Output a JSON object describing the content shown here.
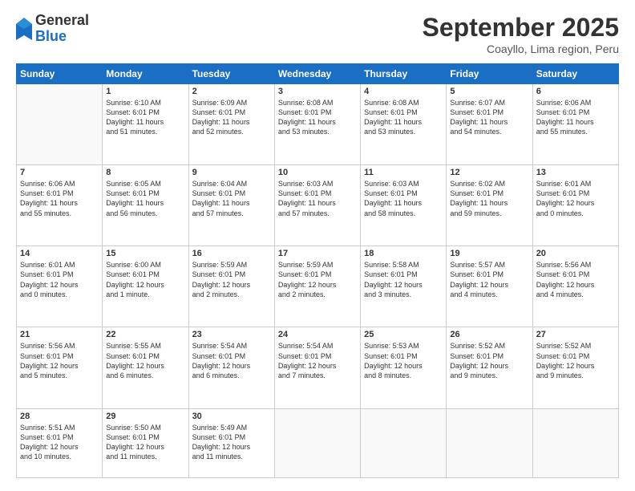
{
  "logo": {
    "general": "General",
    "blue": "Blue"
  },
  "header": {
    "title": "September 2025",
    "subtitle": "Coayllo, Lima region, Peru"
  },
  "days_of_week": [
    "Sunday",
    "Monday",
    "Tuesday",
    "Wednesday",
    "Thursday",
    "Friday",
    "Saturday"
  ],
  "weeks": [
    [
      {
        "day": "",
        "info": ""
      },
      {
        "day": "1",
        "info": "Sunrise: 6:10 AM\nSunset: 6:01 PM\nDaylight: 11 hours\nand 51 minutes."
      },
      {
        "day": "2",
        "info": "Sunrise: 6:09 AM\nSunset: 6:01 PM\nDaylight: 11 hours\nand 52 minutes."
      },
      {
        "day": "3",
        "info": "Sunrise: 6:08 AM\nSunset: 6:01 PM\nDaylight: 11 hours\nand 53 minutes."
      },
      {
        "day": "4",
        "info": "Sunrise: 6:08 AM\nSunset: 6:01 PM\nDaylight: 11 hours\nand 53 minutes."
      },
      {
        "day": "5",
        "info": "Sunrise: 6:07 AM\nSunset: 6:01 PM\nDaylight: 11 hours\nand 54 minutes."
      },
      {
        "day": "6",
        "info": "Sunrise: 6:06 AM\nSunset: 6:01 PM\nDaylight: 11 hours\nand 55 minutes."
      }
    ],
    [
      {
        "day": "7",
        "info": "Sunrise: 6:06 AM\nSunset: 6:01 PM\nDaylight: 11 hours\nand 55 minutes."
      },
      {
        "day": "8",
        "info": "Sunrise: 6:05 AM\nSunset: 6:01 PM\nDaylight: 11 hours\nand 56 minutes."
      },
      {
        "day": "9",
        "info": "Sunrise: 6:04 AM\nSunset: 6:01 PM\nDaylight: 11 hours\nand 57 minutes."
      },
      {
        "day": "10",
        "info": "Sunrise: 6:03 AM\nSunset: 6:01 PM\nDaylight: 11 hours\nand 57 minutes."
      },
      {
        "day": "11",
        "info": "Sunrise: 6:03 AM\nSunset: 6:01 PM\nDaylight: 11 hours\nand 58 minutes."
      },
      {
        "day": "12",
        "info": "Sunrise: 6:02 AM\nSunset: 6:01 PM\nDaylight: 11 hours\nand 59 minutes."
      },
      {
        "day": "13",
        "info": "Sunrise: 6:01 AM\nSunset: 6:01 PM\nDaylight: 12 hours\nand 0 minutes."
      }
    ],
    [
      {
        "day": "14",
        "info": "Sunrise: 6:01 AM\nSunset: 6:01 PM\nDaylight: 12 hours\nand 0 minutes."
      },
      {
        "day": "15",
        "info": "Sunrise: 6:00 AM\nSunset: 6:01 PM\nDaylight: 12 hours\nand 1 minute."
      },
      {
        "day": "16",
        "info": "Sunrise: 5:59 AM\nSunset: 6:01 PM\nDaylight: 12 hours\nand 2 minutes."
      },
      {
        "day": "17",
        "info": "Sunrise: 5:59 AM\nSunset: 6:01 PM\nDaylight: 12 hours\nand 2 minutes."
      },
      {
        "day": "18",
        "info": "Sunrise: 5:58 AM\nSunset: 6:01 PM\nDaylight: 12 hours\nand 3 minutes."
      },
      {
        "day": "19",
        "info": "Sunrise: 5:57 AM\nSunset: 6:01 PM\nDaylight: 12 hours\nand 4 minutes."
      },
      {
        "day": "20",
        "info": "Sunrise: 5:56 AM\nSunset: 6:01 PM\nDaylight: 12 hours\nand 4 minutes."
      }
    ],
    [
      {
        "day": "21",
        "info": "Sunrise: 5:56 AM\nSunset: 6:01 PM\nDaylight: 12 hours\nand 5 minutes."
      },
      {
        "day": "22",
        "info": "Sunrise: 5:55 AM\nSunset: 6:01 PM\nDaylight: 12 hours\nand 6 minutes."
      },
      {
        "day": "23",
        "info": "Sunrise: 5:54 AM\nSunset: 6:01 PM\nDaylight: 12 hours\nand 6 minutes."
      },
      {
        "day": "24",
        "info": "Sunrise: 5:54 AM\nSunset: 6:01 PM\nDaylight: 12 hours\nand 7 minutes."
      },
      {
        "day": "25",
        "info": "Sunrise: 5:53 AM\nSunset: 6:01 PM\nDaylight: 12 hours\nand 8 minutes."
      },
      {
        "day": "26",
        "info": "Sunrise: 5:52 AM\nSunset: 6:01 PM\nDaylight: 12 hours\nand 9 minutes."
      },
      {
        "day": "27",
        "info": "Sunrise: 5:52 AM\nSunset: 6:01 PM\nDaylight: 12 hours\nand 9 minutes."
      }
    ],
    [
      {
        "day": "28",
        "info": "Sunrise: 5:51 AM\nSunset: 6:01 PM\nDaylight: 12 hours\nand 10 minutes."
      },
      {
        "day": "29",
        "info": "Sunrise: 5:50 AM\nSunset: 6:01 PM\nDaylight: 12 hours\nand 11 minutes."
      },
      {
        "day": "30",
        "info": "Sunrise: 5:49 AM\nSunset: 6:01 PM\nDaylight: 12 hours\nand 11 minutes."
      },
      {
        "day": "",
        "info": ""
      },
      {
        "day": "",
        "info": ""
      },
      {
        "day": "",
        "info": ""
      },
      {
        "day": "",
        "info": ""
      }
    ]
  ]
}
